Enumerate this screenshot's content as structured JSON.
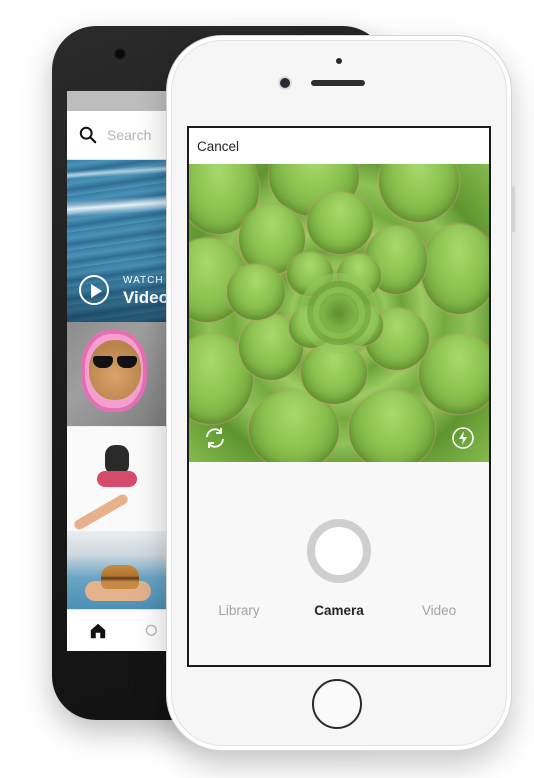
{
  "android_screen": {
    "search": {
      "placeholder": "Search"
    },
    "feed": {
      "video_tile": {
        "watch_label": "WATCH",
        "video_label": "Video"
      }
    }
  },
  "iphone_screen": {
    "topbar": {
      "cancel_label": "Cancel"
    },
    "tabs": [
      {
        "label": "Library",
        "active": false
      },
      {
        "label": "Camera",
        "active": true
      },
      {
        "label": "Video",
        "active": false
      }
    ]
  },
  "icons": [
    "search-icon",
    "play-icon",
    "home-icon",
    "camera-flip-icon",
    "flash-icon",
    "shutter-button"
  ],
  "colors": {
    "accent_text": "#262626",
    "inactive_tab": "#a3a3a3",
    "shutter_ring": "#cfcfcf"
  }
}
